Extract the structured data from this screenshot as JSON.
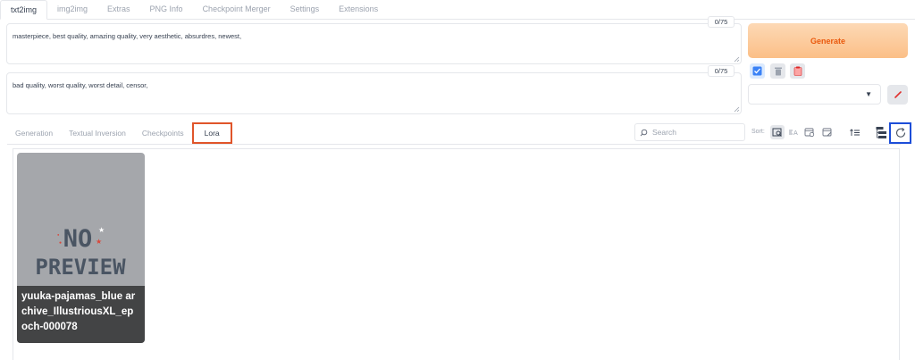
{
  "top_tabs": [
    "txt2img",
    "img2img",
    "Extras",
    "PNG Info",
    "Checkpoint Merger",
    "Settings",
    "Extensions"
  ],
  "prompt": {
    "value": "masterpiece, best quality, amazing quality, very aesthetic, absurdres, newest,",
    "counter": "0/75"
  },
  "negative_prompt": {
    "value": "bad quality, worst quality, worst detail, censor,",
    "counter": "0/75"
  },
  "generate_label": "Generate",
  "sub_tabs": [
    "Generation",
    "Textual Inversion",
    "Checkpoints",
    "Lora"
  ],
  "search": {
    "placeholder": "Search"
  },
  "sort_label": "Sort:",
  "card": {
    "placeholder_line1": "NO",
    "placeholder_line2": "PREVIEW",
    "title_lines": [
      "yuuka-pajamas_blue ar",
      "chive_IllustriousXL_ep",
      "och-000078"
    ]
  },
  "colors": {
    "generate_text": "#ea580c",
    "lora_tab_highlight": "#e0552a",
    "refresh_highlight": "#1d4ed8",
    "checkbox_blue": "#3b82f6",
    "pencil_red": "#e0312e"
  },
  "icons": [
    "checkbox-icon",
    "trash-icon",
    "clipboard-icon",
    "chevron-down-icon",
    "pencil-icon",
    "search-icon",
    "sort-path-icon",
    "sort-name-icon",
    "sort-date-created-icon",
    "sort-date-modified-icon",
    "sort-direction-icon",
    "tree-view-icon",
    "refresh-icon"
  ]
}
